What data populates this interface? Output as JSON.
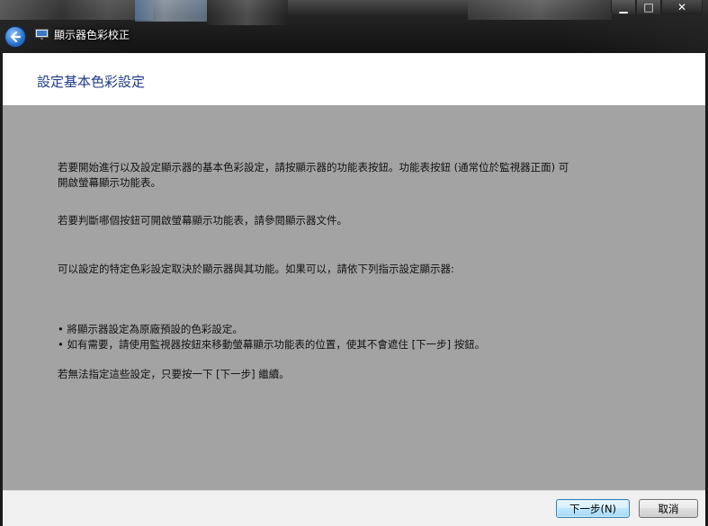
{
  "window": {
    "title": "顯示器色彩校正",
    "buttons": {
      "minimize": "▁",
      "maximize": "□",
      "close": "✕"
    }
  },
  "header": {
    "title": "設定基本色彩設定"
  },
  "body": {
    "para1_line1": "若要開始進行以及設定顯示器的基本色彩設定，請按顯示器的功能表按鈕。功能表按鈕 (通常位於監視器正面) 可",
    "para1_line2": "開啟螢幕顯示功能表。",
    "para2": "若要判斷哪個按鈕可開啟螢幕顯示功能表，請參閱顯示器文件。",
    "para3": "可以設定的特定色彩設定取決於顯示器與其功能。如果可以，請依下列指示設定顯示器:",
    "bullets": [
      "• 將顯示器設定為原廠預設的色彩設定。",
      "• 如有需要，請使用監視器按鈕來移動螢幕顯示功能表的位置，使其不會遮住 [下一步] 按鈕。"
    ],
    "para4": "若無法指定這些設定，只要按一下 [下一步] 繼續。"
  },
  "footer": {
    "next_label": "下一步(N)",
    "cancel_label": "取消"
  },
  "icons": {
    "back": "back-arrow-icon",
    "app": "monitor-icon"
  },
  "colors": {
    "header_title": "#1e3a8a",
    "body_bg": "#a3a3a3",
    "footer_bg": "#f0f0f0"
  }
}
